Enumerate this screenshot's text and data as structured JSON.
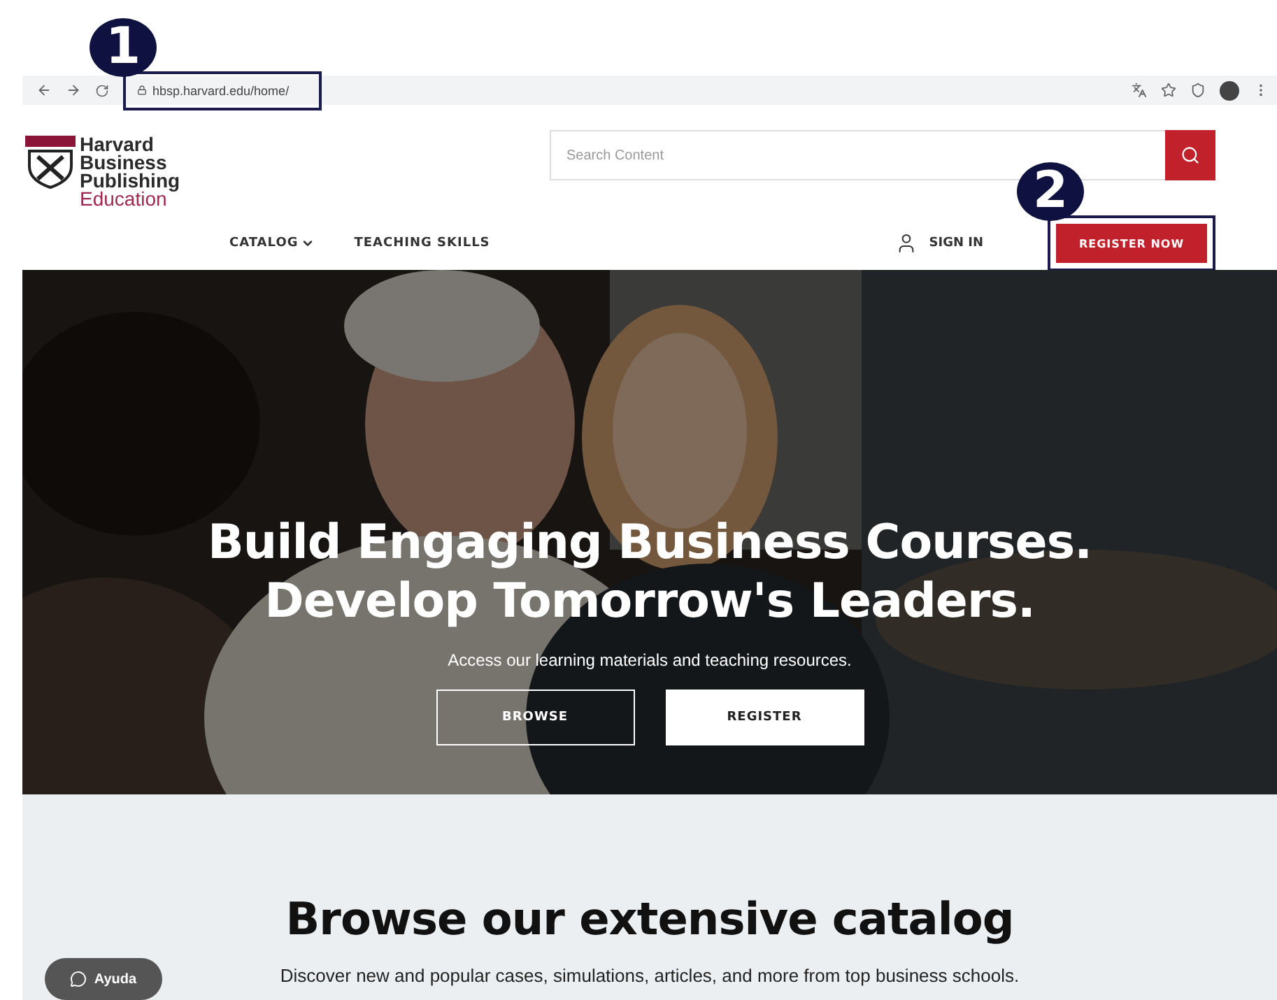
{
  "browser": {
    "url": "hbsp.harvard.edu/home/"
  },
  "annotations": [
    {
      "number": "1"
    },
    {
      "number": "2"
    }
  ],
  "logo": {
    "lines": [
      "Harvard",
      "Business",
      "Publishing"
    ],
    "sub": "Education"
  },
  "search": {
    "placeholder": "Search Content"
  },
  "nav": [
    {
      "label": "CATALOG",
      "dropdown": true
    },
    {
      "label": "TEACHING SKILLS",
      "dropdown": false
    }
  ],
  "sign_in": "SIGN IN",
  "register_now": "REGISTER NOW",
  "hero": {
    "title_lines": [
      "Build Engaging Business Courses.",
      "Develop Tomorrow's Leaders."
    ],
    "subtitle": "Access our learning materials and teaching resources.",
    "buttons": [
      {
        "label": "BROWSE",
        "kind": "outline"
      },
      {
        "label": "REGISTER",
        "kind": "solid"
      }
    ]
  },
  "catalog": {
    "heading": "Browse our extensive catalog",
    "description": "Discover new and popular cases, simulations, articles, and more from top business schools."
  },
  "help": {
    "label": "Ayuda"
  }
}
